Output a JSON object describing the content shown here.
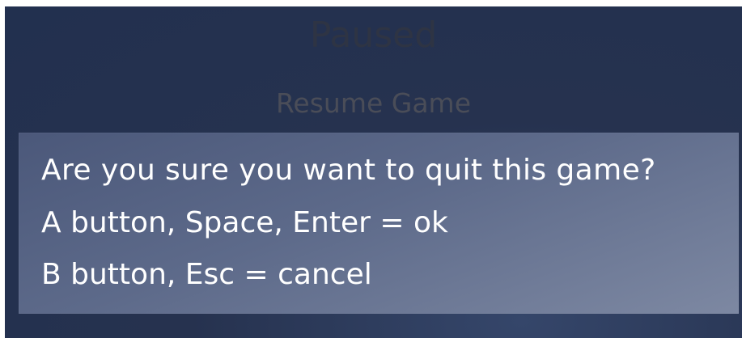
{
  "pause_menu": {
    "title": "Paused",
    "resume_label": "Resume Game"
  },
  "quit_dialog": {
    "question": "Are you sure you want to quit this game?",
    "confirm_hint": "A button, Space, Enter = ok",
    "cancel_hint": "B button, Esc = cancel"
  },
  "colors": {
    "background": "#24314f",
    "dialog_start": "#4b587a",
    "dialog_end": "#7d88a2",
    "dimmed_text": "#2e3444",
    "text": "#ffffff"
  }
}
